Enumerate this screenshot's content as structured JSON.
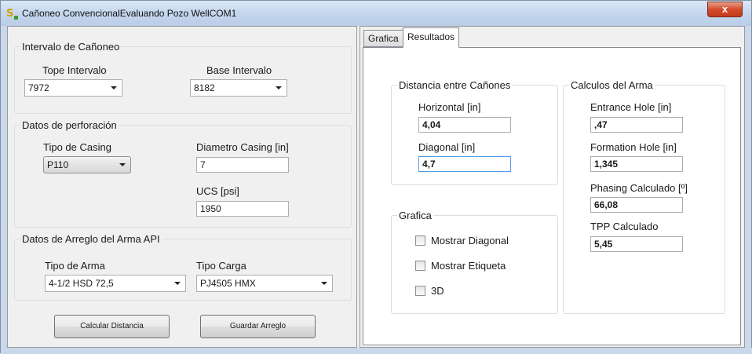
{
  "window": {
    "title": "Cañoneo ConvencionalEvaluando Pozo WellCOM1",
    "app_icon": "s-app-icon",
    "close_label": "x"
  },
  "left": {
    "intervalo": {
      "legend": "Intervalo de Cañoneo",
      "tope_label": "Tope Intervalo",
      "tope_value": "7972",
      "base_label": "Base Intervalo",
      "base_value": "8182"
    },
    "perforacion": {
      "legend": "Datos de perforación",
      "tipo_casing_label": "Tipo de Casing",
      "tipo_casing_value": "P110",
      "diametro_label": "Diametro Casing [in]",
      "diametro_value": "7",
      "ucs_label": "UCS [psi]",
      "ucs_value": "1950"
    },
    "arreglo": {
      "legend": "Datos de Arreglo del Arma API",
      "tipo_arma_label": "Tipo de Arma",
      "tipo_arma_value": "4-1/2 HSD 72,5",
      "tipo_carga_label": "Tipo Carga",
      "tipo_carga_value": "PJ4505 HMX"
    },
    "buttons": {
      "calcular": "Calcular Distancia",
      "guardar": "Guardar Arreglo"
    }
  },
  "right": {
    "tabs": [
      {
        "label": "Grafica",
        "active": false
      },
      {
        "label": "Resultados",
        "active": true
      }
    ],
    "distancia": {
      "legend": "Distancia entre Cañones",
      "horizontal_label": "Horizontal [in]",
      "horizontal_value": "4,04",
      "diagonal_label": "Diagonal [in]",
      "diagonal_value": "4,7"
    },
    "grafica": {
      "legend": "Grafica",
      "options": [
        {
          "label": "Mostrar Diagonal",
          "checked": false
        },
        {
          "label": "Mostrar Etiqueta",
          "checked": false
        },
        {
          "label": "3D",
          "checked": false
        }
      ]
    },
    "calculos": {
      "legend": "Calculos del Arma",
      "entrance_label": "Entrance Hole [in]",
      "entrance_value": ",47",
      "formation_label": "Formation Hole [in]",
      "formation_value": "1,345",
      "phasing_label": "Phasing Calculado [º]",
      "phasing_value": "66,08",
      "tpp_label": "TPP Calculado",
      "tpp_value": "5,45"
    }
  }
}
